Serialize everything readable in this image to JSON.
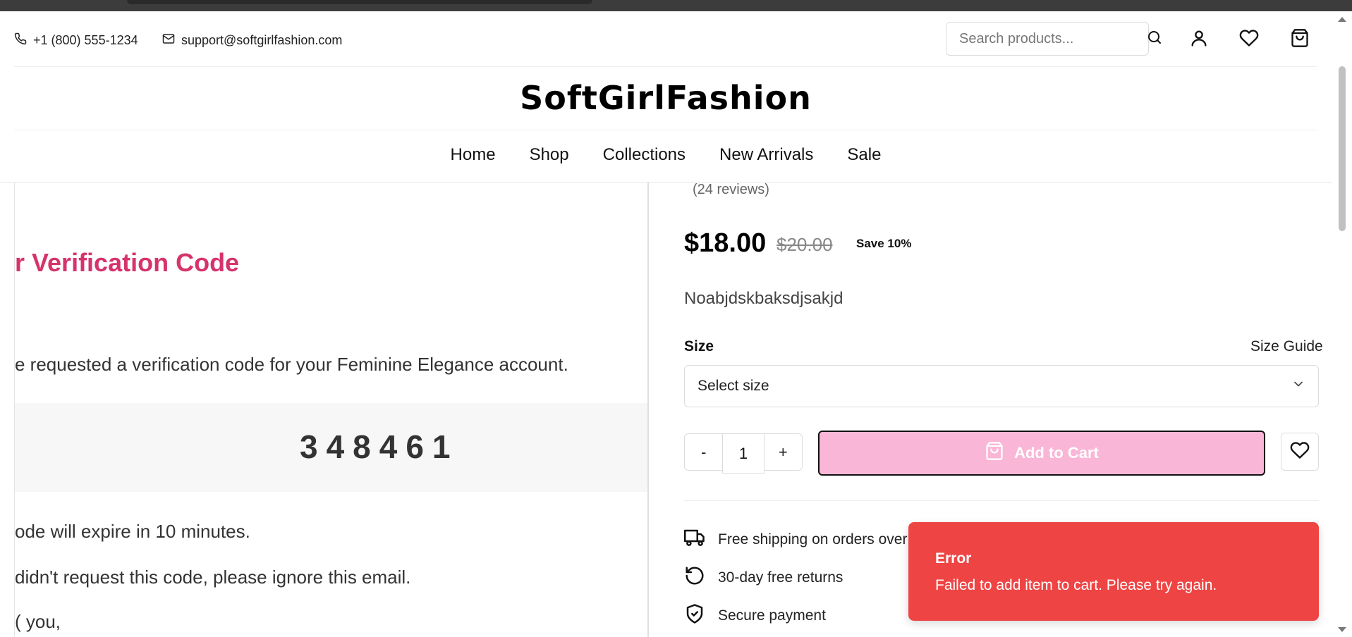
{
  "header": {
    "phone": "+1 (800) 555-1234",
    "email": "support@softgirlfashion.com",
    "search_placeholder": "Search products...",
    "logo": "SoftGirlFashion"
  },
  "nav": [
    "Home",
    "Shop",
    "Collections",
    "New Arrivals",
    "Sale"
  ],
  "email_preview": {
    "title": "r Verification Code",
    "intro": "e requested a verification code for your Feminine Elegance account.",
    "code": "348461",
    "expiry": "ode will expire in 10 minutes.",
    "ignore": "didn't request this code, please ignore this email.",
    "signoff": "( you,"
  },
  "product": {
    "reviews": "(24 reviews)",
    "price": "$18.00",
    "old_price": "$20.00",
    "save": "Save 10%",
    "description": "Noabjdskbaksdjsakjd",
    "size_label": "Size",
    "size_guide": "Size Guide",
    "size_select": "Select size",
    "qty_minus": "-",
    "qty_value": "1",
    "qty_plus": "+",
    "add_to_cart": "Add to Cart"
  },
  "features": [
    "Free shipping on orders over",
    "30-day free returns",
    "Secure payment"
  ],
  "toast": {
    "title": "Error",
    "message": "Failed to add item to cart. Please try again."
  },
  "colors": {
    "accent_pink": "#f9b6d6",
    "title_pink": "#d6336c",
    "error_red": "#ef4444"
  },
  "icons": [
    "phone-icon",
    "mail-icon",
    "search-icon",
    "user-icon",
    "heart-icon",
    "cart-icon",
    "chevron-down-icon",
    "bag-icon",
    "truck-icon",
    "return-icon",
    "shield-icon"
  ]
}
